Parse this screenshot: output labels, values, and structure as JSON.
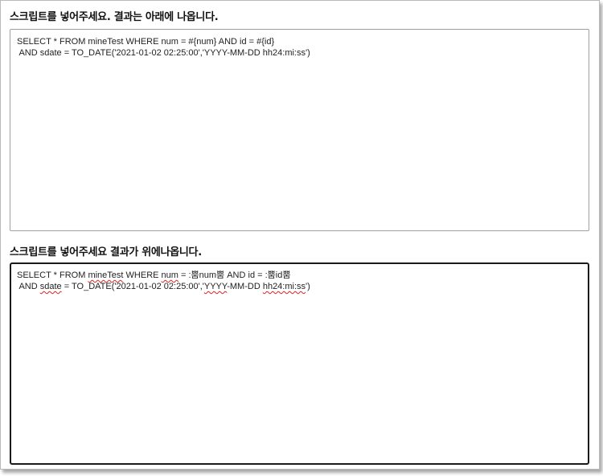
{
  "input_section": {
    "heading": "스크립트를 넣어주세요. 결과는 아래에 나옵니다.",
    "script_lines": [
      "SELECT * FROM mineTest WHERE num = #{num} AND id = #{id}",
      " AND sdate = TO_DATE('2021-01-02 02:25:00','YYYY-MM-DD hh24:mi:ss')"
    ]
  },
  "output_section": {
    "heading": "스크립트를 넣어주세요 결과가 위에나옵니다.",
    "result_line1": {
      "p1": "SELECT * FROM ",
      "w_mineTest": "mineTest",
      "p2": " WHERE ",
      "w_num": "num",
      "p3": " = :뿜num뿜 AND id = :뿜id뿜"
    },
    "result_line2": {
      "p1": " AND ",
      "w_sdate": "sdate",
      "p2": " = TO_DATE('2021-01-02 02:25:00','",
      "w_yyyy": "YYYY",
      "p3": "-MM-DD ",
      "w_hh24": "hh24:mi:ss",
      "p4": "')"
    }
  }
}
